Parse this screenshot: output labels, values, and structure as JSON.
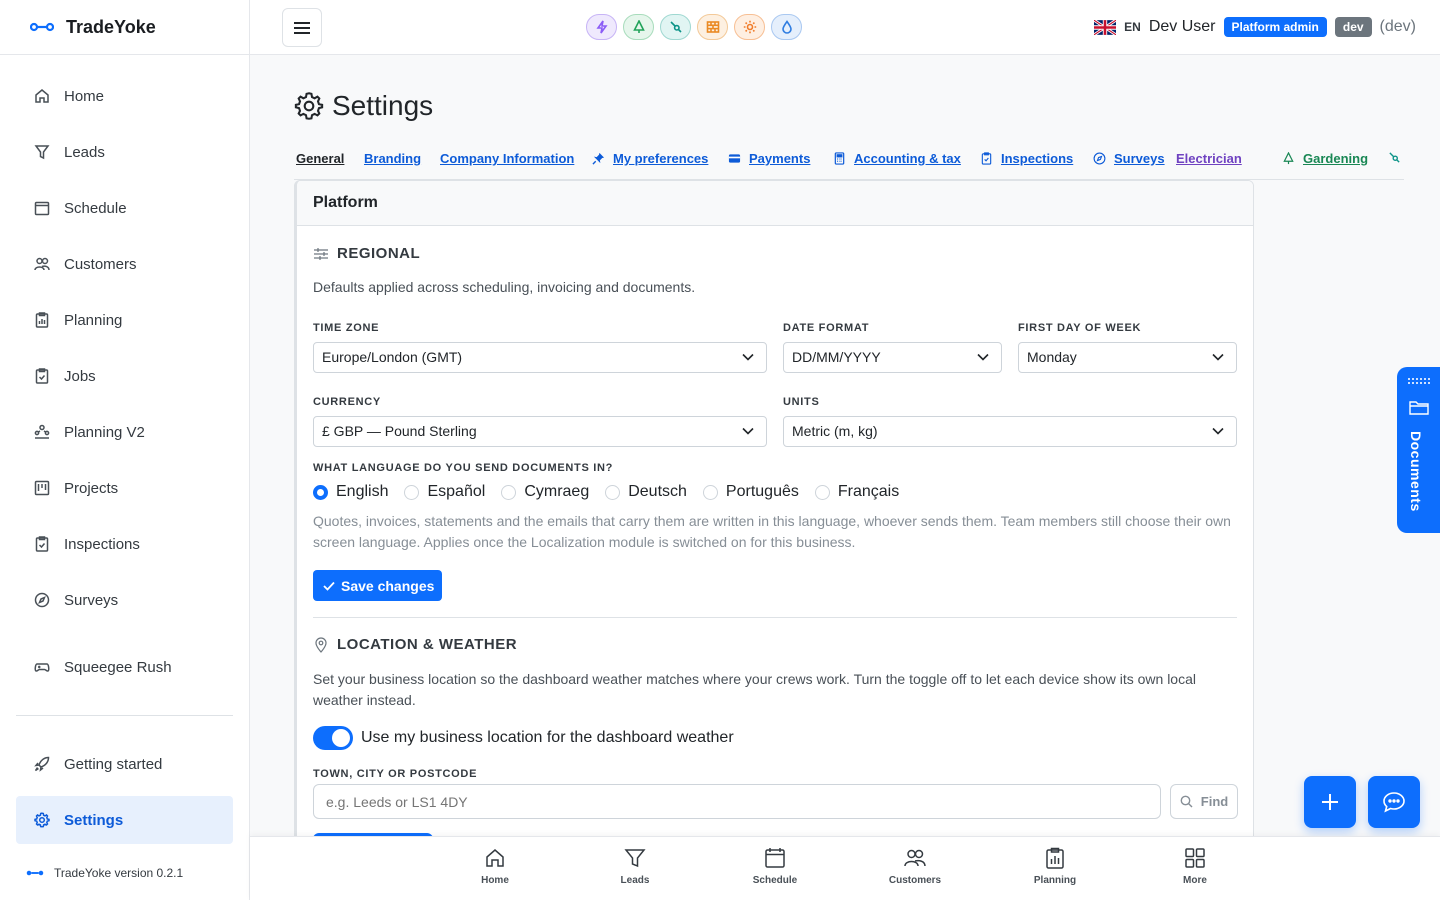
{
  "app": {
    "name": "TradeYoke",
    "version_text": "TradeYoke version 0.2.1"
  },
  "sidebar": {
    "items": [
      {
        "label": "Home",
        "icon": "home-icon"
      },
      {
        "label": "Leads",
        "icon": "filter-icon"
      },
      {
        "label": "Schedule",
        "icon": "calendar-icon"
      },
      {
        "label": "Customers",
        "icon": "users-icon"
      },
      {
        "label": "Planning",
        "icon": "clipboard-chart-icon"
      },
      {
        "label": "Jobs",
        "icon": "clipboard-check-icon"
      },
      {
        "label": "Planning V2",
        "icon": "people-network-icon"
      },
      {
        "label": "Projects",
        "icon": "kanban-icon"
      },
      {
        "label": "Inspections",
        "icon": "clipboard-check-icon"
      },
      {
        "label": "Surveys",
        "icon": "compass-icon"
      },
      {
        "label": "Squeegee Rush",
        "icon": "gamepad-icon"
      }
    ],
    "footer_items": [
      {
        "label": "Getting started",
        "icon": "rocket-icon"
      },
      {
        "label": "Settings",
        "icon": "gear-icon",
        "active": true
      }
    ]
  },
  "header": {
    "modules": [
      {
        "name": "lightning-icon",
        "color": "#8b5cf6",
        "bg": "#efe9fd"
      },
      {
        "name": "tree-icon",
        "color": "#22a35a",
        "bg": "#e6f6ec"
      },
      {
        "name": "wrench-icon",
        "color": "#0d9488",
        "bg": "#e1f5f3"
      },
      {
        "name": "brick-icon",
        "color": "#ea8a24",
        "bg": "#fdf0e1"
      },
      {
        "name": "sun-icon",
        "color": "#f07c2a",
        "bg": "#feefe2"
      },
      {
        "name": "droplet-icon",
        "color": "#2f7de1",
        "bg": "#e5effc"
      }
    ],
    "language_code": "EN",
    "user_name": "Dev User",
    "role_badge": "Platform admin",
    "env_badge": "dev",
    "env_text": "(dev)"
  },
  "page": {
    "title": "Settings",
    "tabs": [
      {
        "label": "General",
        "active": true
      },
      {
        "label": "Branding"
      },
      {
        "label": "Company Information"
      },
      {
        "label": "My preferences",
        "icon": "pin-icon"
      },
      {
        "label": "Payments",
        "icon": "credit-card-icon"
      },
      {
        "label": "Accounting & tax",
        "icon": "calculator-icon"
      },
      {
        "label": "Inspections",
        "icon": "clipboard-check-icon"
      },
      {
        "label": "Surveys",
        "icon": "compass-icon"
      },
      {
        "label": "Electrician",
        "icon": "lightning-icon"
      },
      {
        "label": "Gardening",
        "icon": "tree-icon"
      },
      {
        "label": "",
        "icon": "wrench-icon"
      }
    ]
  },
  "platform": {
    "card_title": "Platform",
    "regional": {
      "title": "REGIONAL",
      "description": "Defaults applied across scheduling, invoicing and documents.",
      "time_zone_label": "TIME ZONE",
      "time_zone_value": "Europe/London (GMT)",
      "date_format_label": "DATE FORMAT",
      "date_format_value": "DD/MM/YYYY",
      "first_day_label": "FIRST DAY OF WEEK",
      "first_day_value": "Monday",
      "currency_label": "CURRENCY",
      "currency_value": "£ GBP — Pound Sterling",
      "units_label": "UNITS",
      "units_value": "Metric (m, kg)",
      "language_label": "WHAT LANGUAGE DO YOU SEND DOCUMENTS IN?",
      "languages": [
        {
          "label": "English",
          "selected": true
        },
        {
          "label": "Español"
        },
        {
          "label": "Cymraeg"
        },
        {
          "label": "Deutsch"
        },
        {
          "label": "Português"
        },
        {
          "label": "Français"
        }
      ],
      "language_hint": "Quotes, invoices, statements and the emails that carry them are written in this language, whoever sends them. Team members still choose their own screen language. Applies once the Localization module is switched on for this business.",
      "save_label": "Save changes"
    },
    "location": {
      "title": "LOCATION & WEATHER",
      "description": "Set your business location so the dashboard weather matches where your crews work. Turn the toggle off to let each device show its own local weather instead.",
      "toggle_on": true,
      "toggle_label": "Use my business location for the dashboard weather",
      "field_label": "TOWN, CITY OR POSTCODE",
      "field_placeholder": "e.g. Leeds or LS1 4DY",
      "field_value": "",
      "find_label": "Find"
    }
  },
  "docs_panel": {
    "label": "Documents"
  },
  "bottom_nav": [
    {
      "label": "Home",
      "icon": "home-icon"
    },
    {
      "label": "Leads",
      "icon": "filter-icon"
    },
    {
      "label": "Schedule",
      "icon": "calendar-icon"
    },
    {
      "label": "Customers",
      "icon": "users-icon"
    },
    {
      "label": "Planning",
      "icon": "clipboard-chart-icon"
    },
    {
      "label": "More",
      "icon": "grid-icon"
    }
  ],
  "colors": {
    "accent": "#0d6efd",
    "active_bg": "#e7f0fd"
  }
}
